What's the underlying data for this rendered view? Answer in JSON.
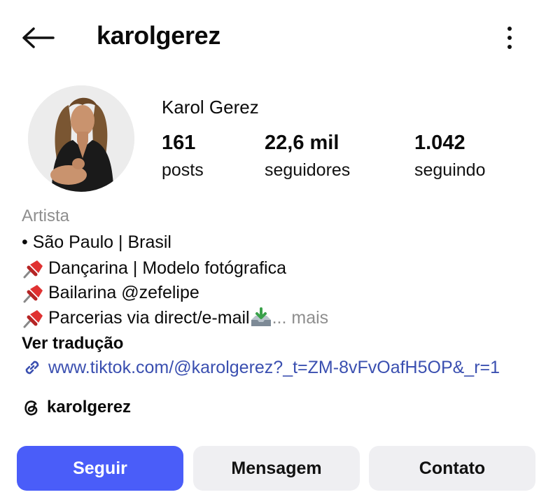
{
  "header": {
    "username": "karolgerez"
  },
  "profile": {
    "display_name": "Karol Gerez",
    "stats": [
      {
        "value": "161",
        "label": "posts"
      },
      {
        "value": "22,6 mil",
        "label": "seguidores"
      },
      {
        "value": "1.042",
        "label": "seguindo"
      }
    ]
  },
  "bio": {
    "category": "Artista",
    "lines": [
      "• São Paulo | Brasil",
      "Dançarina | Modelo fotógrafica",
      "Bailarina @zefelipe",
      "Parcerias via direct/e-mail "
    ],
    "more_label": "... mais",
    "translate_label": "Ver tradução",
    "link": "www.tiktok.com/@karolgerez?_t=ZM-8vFvOafH5OP&_r=1",
    "threads_handle": "karolgerez"
  },
  "actions": {
    "follow_label": "Seguir",
    "message_label": "Mensagem",
    "contact_label": "Contato"
  },
  "colors": {
    "follow_bg": "#4a5df9",
    "link": "#3a4fb0",
    "muted": "#8e8e8e"
  },
  "icons": {
    "back": "arrow-left-icon",
    "more": "more-vertical-icon",
    "pin": "pushpin-icon",
    "download": "inbox-download-icon",
    "link": "link-icon",
    "threads": "threads-icon"
  }
}
